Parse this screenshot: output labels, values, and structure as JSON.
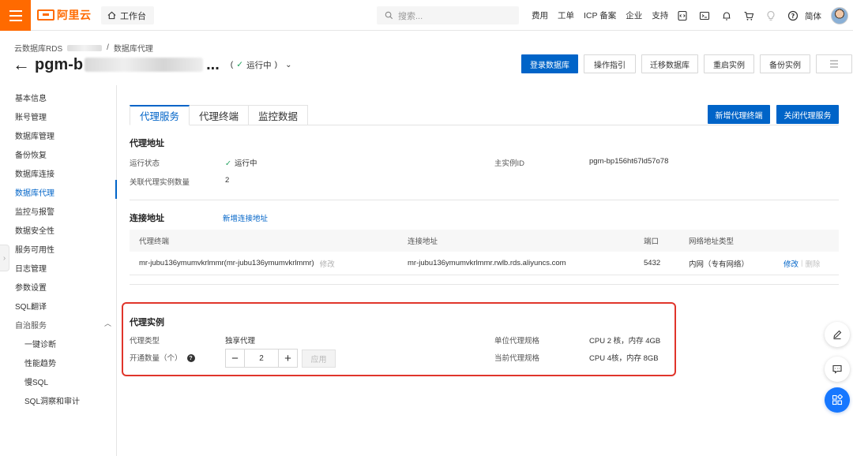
{
  "topbar": {
    "logo_text": "阿里云",
    "workbench_label": "工作台",
    "search_placeholder": "搜索...",
    "links": [
      "费用",
      "工单",
      "ICP 备案",
      "企业",
      "支持"
    ],
    "lang": "简体",
    "icons": [
      "code-icon",
      "terminal-icon",
      "bell-icon",
      "cart-icon",
      "lightbulb-icon",
      "help-icon"
    ]
  },
  "breadcrumb": {
    "root": "云数据库RDS",
    "sep": "/",
    "current": "数据库代理"
  },
  "header": {
    "title_prefix": "pgm-b",
    "title_suffix": "...",
    "status": "运行中",
    "buttons": [
      "登录数据库",
      "操作指引",
      "迁移数据库",
      "重启实例",
      "备份实例"
    ]
  },
  "sidebar": {
    "items": [
      "基本信息",
      "账号管理",
      "数据库管理",
      "备份恢复",
      "数据库连接",
      "数据库代理",
      "监控与报警",
      "数据安全性",
      "服务可用性",
      "日志管理",
      "参数设置",
      "SQL翻译",
      "自治服务"
    ],
    "active": "数据库代理",
    "sub_items": [
      "一键诊断",
      "性能趋势",
      "慢SQL",
      "SQL洞察和审计"
    ]
  },
  "tabs": [
    "代理服务",
    "代理终端",
    "监控数据"
  ],
  "main_buttons": [
    "新增代理终端",
    "关闭代理服务"
  ],
  "proxy_address": {
    "title": "代理地址",
    "run_status_label": "运行状态",
    "run_status_value": "运行中",
    "linked_count_label": "关联代理实例数量",
    "linked_count_value": "2",
    "main_instance_label": "主实例ID",
    "main_instance_value": "pgm-bp156ht67ld57o78"
  },
  "connection": {
    "title": "连接地址",
    "add_link": "新增连接地址",
    "columns": [
      "代理终端",
      "连接地址",
      "端口",
      "网络地址类型"
    ],
    "rows": [
      {
        "terminal": "mr-jubu136ymumvkrlmmr(mr-jubu136ymumvkrlmmr)",
        "terminal_edit": "修改",
        "address": "mr-jubu136ymumvkrlmmr.rwlb.rds.aliyuncs.com",
        "port": "5432",
        "net_type": "内网（专有网络）",
        "op_edit": "修改",
        "op_sep": "|",
        "op_delete": "删除"
      }
    ]
  },
  "proxy_instance": {
    "title": "代理实例",
    "type_label": "代理类型",
    "type_value": "独享代理",
    "count_label": "开通数量（个）",
    "count_value": "2",
    "apply_label": "应用",
    "unit_spec_label": "单位代理规格",
    "unit_spec_value": "CPU 2 核，内存 4GB",
    "current_spec_label": "当前代理规格",
    "current_spec_value": "CPU 4核，内存 8GB"
  },
  "colors": {
    "brand": "#ff6a00",
    "primary": "#0064c8",
    "success": "#1da05b",
    "highlight": "#e0352b"
  }
}
